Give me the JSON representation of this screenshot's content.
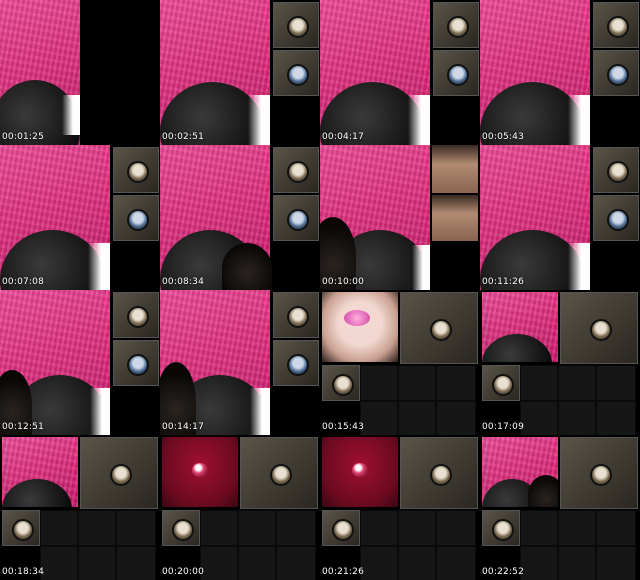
{
  "timestamps": [
    "00:01:25",
    "00:02:51",
    "00:04:17",
    "00:05:43",
    "00:07:08",
    "00:08:34",
    "00:10:00",
    "00:11:26",
    "00:12:51",
    "00:14:17",
    "00:15:43",
    "00:17:09",
    "00:18:34",
    "00:20:00",
    "00:21:26",
    "00:22:52"
  ],
  "colors": {
    "background": "#000000",
    "fabric_pink": "#e0307f",
    "red_screen": "#8a0c28"
  },
  "icons": {
    "participant_avatar": "person-avatar-icon",
    "participant_avatar_alt": "person-avatar-blue-icon"
  }
}
